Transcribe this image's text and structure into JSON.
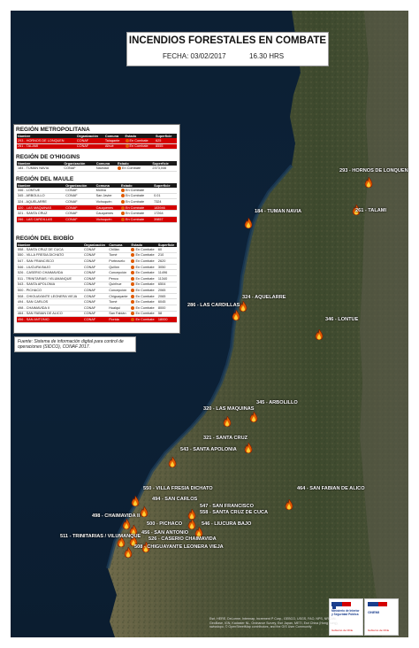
{
  "header": {
    "title": "INCENDIOS FORESTALES EN COMBATE",
    "date": "FECHA: 03/02/2017",
    "hour": "16.30 HRS"
  },
  "colors": {
    "sea": "#0c1f33",
    "highlight": "#d40000",
    "fire": "#e05a00"
  },
  "regions": [
    {
      "name": "REGIÓN METROPOLITANA",
      "columns": [
        "Nombre",
        "Organización",
        "Comuna",
        "Estado",
        "Superficie"
      ],
      "rows": [
        {
          "n": "293 - HORNOS DE LONQUEN",
          "o": "CONAF",
          "c": "Talagante",
          "e": "En Combate",
          "s": "625",
          "hl": true
        },
        {
          "n": "261 - TALAMI",
          "o": "CONAF",
          "c": "Alhué",
          "e": "En Combate",
          "s": "8555",
          "hl": true
        }
      ]
    },
    {
      "name": "REGIÓN DE O'HIGGINS",
      "columns": [
        "Nombre",
        "Organización",
        "Comuna",
        "Estado",
        "Superficie"
      ],
      "rows": [
        {
          "n": "184 - TUMAN NAVIA",
          "o": "CONAF",
          "c": "Navidad",
          "e": "En Combate",
          "s": "2373,046",
          "hl": false
        }
      ]
    },
    {
      "name": "REGIÓN DEL MAULE",
      "columns": [
        "Nombre",
        "Organización",
        "Comuna",
        "Estado",
        "Superficie"
      ],
      "rows": [
        {
          "n": "346 - LONTUE",
          "o": "CONAF",
          "c": "Molina",
          "e": "En Combate",
          "s": "",
          "hl": false
        },
        {
          "n": "345 - ARBOLILLO",
          "o": "CONAF",
          "c": "San Javier",
          "e": "En Combate",
          "s": "0.01",
          "hl": false
        },
        {
          "n": "324 - AQUELARRE",
          "o": "CONAF",
          "c": "Vichuquén",
          "e": "En Combate",
          "s": "7324",
          "hl": false
        },
        {
          "n": "320 - LAS MAQUINAS",
          "o": "CONAF",
          "c": "Cauquenes",
          "e": "En Combate",
          "s": "183946",
          "hl": true
        },
        {
          "n": "321 - SANTA CRUZ",
          "o": "CONAF",
          "c": "Cauquenes",
          "e": "En Combate",
          "s": "17264",
          "hl": false
        },
        {
          "n": "286 - LAS CARDILLAS",
          "o": "CONAF",
          "c": "Vichuquén",
          "e": "En Combate",
          "s": "39857",
          "hl": true
        }
      ]
    },
    {
      "name": "REGIÓN DEL BIOBÍO",
      "columns": [
        "Nombre",
        "Organización",
        "Comuna",
        "Estado",
        "Superficie"
      ],
      "rows": [
        {
          "n": "558 - SANTA CRUZ DE CUCA",
          "o": "CONAF",
          "c": "Chillán",
          "e": "En Combate",
          "s": "60",
          "hl": false
        },
        {
          "n": "550 - VILLA FRESIA DICHATO",
          "o": "CONAF",
          "c": "Tomé",
          "e": "En Combate",
          "s": "210",
          "hl": false
        },
        {
          "n": "547 - SAN FRANCISCO",
          "o": "CONAF",
          "c": "Portezuelo",
          "e": "En Combate",
          "s": "2620",
          "hl": false
        },
        {
          "n": "546 - LIUCURA BAJO",
          "o": "CONAF",
          "c": "Quillón",
          "e": "En Combate",
          "s": "3050",
          "hl": false
        },
        {
          "n": "526 - CASERIO CHAIMAVIDA",
          "o": "CONAF",
          "c": "Concepción",
          "e": "En Combate",
          "s": "11496",
          "hl": false
        },
        {
          "n": "511 - TRINITARIAS / VILUMANQUE",
          "o": "CONAF",
          "c": "Penco",
          "e": "En Combate",
          "s": "11340",
          "hl": false
        },
        {
          "n": "543 - SANTA APOLONIA",
          "o": "CONAF",
          "c": "Quirihue",
          "e": "En Combate",
          "s": "6504",
          "hl": false
        },
        {
          "n": "500 - PICHACO",
          "o": "CONAF",
          "c": "Concepción",
          "e": "En Combate",
          "s": "2065",
          "hl": false
        },
        {
          "n": "508 - CHIGUAYANTE LEONERA VIEJA",
          "o": "CONAF",
          "c": "Chiguayante",
          "e": "En Combate",
          "s": "2065",
          "hl": false
        },
        {
          "n": "494 - SAN CARLOS",
          "o": "CONAF",
          "c": "Tomé",
          "e": "En Combate",
          "s": "6045",
          "hl": false
        },
        {
          "n": "498 - CHAIMAVIDA II",
          "o": "CONAF",
          "c": "Hualqui",
          "e": "En Combate",
          "s": "8000",
          "hl": false
        },
        {
          "n": "464 - SAN FABIAN DE ALICO",
          "o": "CONAF",
          "c": "San Fabián",
          "e": "En Combate",
          "s": "58",
          "hl": false
        },
        {
          "n": "456 - SAN ANTONIO",
          "o": "CONAF",
          "c": "Florida",
          "e": "En Combate",
          "s": "18000",
          "hl": true
        }
      ]
    }
  ],
  "source_note": "Fuente: Sistema de información digital para control de operaciones (SIDCO), CONAF 2017.",
  "fires": [
    {
      "label": "293 - HORNOS DE LONQUEN",
      "icon": "fire-icon"
    },
    {
      "label": "261 - TALAMI",
      "icon": "fire-icon"
    },
    {
      "label": "184 - TUMAN NAVIA",
      "icon": "fire-icon"
    },
    {
      "label": "324 - AQUELARRE",
      "icon": "fire-icon"
    },
    {
      "label": "286 - LAS CARDILLAS",
      "icon": "fire-icon"
    },
    {
      "label": "346 - LONTUE",
      "icon": "fire-icon"
    },
    {
      "label": "345 - ARBOLILLO",
      "icon": "fire-icon"
    },
    {
      "label": "320 - LAS MAQUINAS",
      "icon": "fire-icon"
    },
    {
      "label": "321 - SANTA CRUZ",
      "icon": "fire-icon"
    },
    {
      "label": "543 - SANTA APOLONIA",
      "icon": "fire-icon"
    },
    {
      "label": "464 - SAN FABIAN DE ALICO",
      "icon": "fire-icon"
    },
    {
      "label": "550 - VILLA FRESIA DICHATO",
      "icon": "fire-icon"
    },
    {
      "label": "494 - SAN CARLOS",
      "icon": "fire-icon"
    },
    {
      "label": "547 - SAN FRANCISCO",
      "icon": "fire-icon"
    },
    {
      "label": "558 - SANTA CRUZ DE CUCA",
      "icon": "fire-icon"
    },
    {
      "label": "498 - CHAIMAVIDA II",
      "icon": "fire-icon"
    },
    {
      "label": "546 - LIUCURA BAJO",
      "icon": "fire-icon"
    },
    {
      "label": "500 - PICHACO",
      "icon": "fire-icon"
    },
    {
      "label": "456 - SAN ANTONIO",
      "icon": "fire-icon"
    },
    {
      "label": "511 - TRINITARIAS / VILUMANQUE",
      "icon": "fire-icon"
    },
    {
      "label": "526 - CASERIO CHAIMAVIDA",
      "icon": "fire-icon"
    },
    {
      "label": "508 - CHIGUAYANTE LEONERA VIEJA",
      "icon": "fire-icon"
    }
  ],
  "logos": [
    {
      "text": "Ministerio de Interior y Seguridad Pública",
      "sub": "Gobierno de Chile"
    },
    {
      "text": "ONEMI",
      "sub": "Gobierno de Chile"
    }
  ],
  "copyright": "Esri, HERE, DeLorme, Intermap, increment P Corp., GEBCO, USGS, FAO, NPS, NRCAN, GeoBase, IGN, Kadaster NL, Ordnance Survey, Esri Japan, METI, Esri China (Hong Kong), swisstopo, © OpenStreetMap contributors, and the GIS User Community"
}
